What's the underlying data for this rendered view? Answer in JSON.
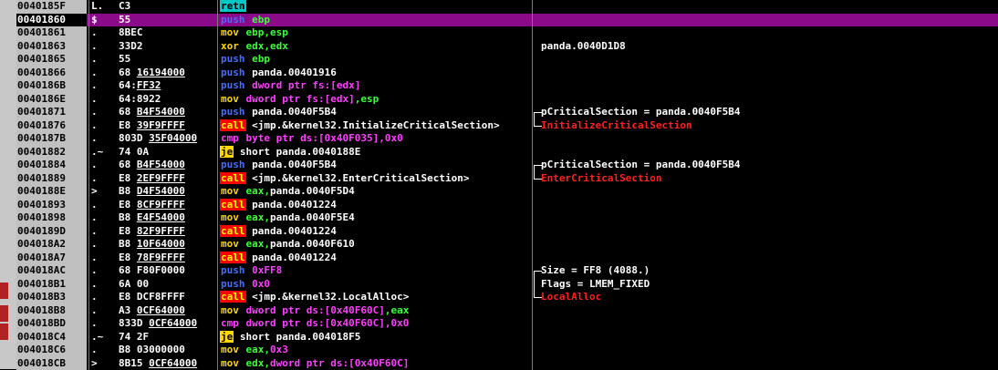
{
  "rows": [
    {
      "addr": "0040185F",
      "flag": "L.",
      "hex": "C3",
      "hex_ul": "",
      "mn": "retn",
      "mn_cls": "retn",
      "ops": [],
      "cmt": ""
    },
    {
      "addr": "00401860",
      "flag": "$",
      "hex": "55",
      "hex_ul": "",
      "mn": "push",
      "mn_cls": "push",
      "ops": [
        [
          "ebp",
          "reg"
        ]
      ],
      "cmt": "",
      "selected": true
    },
    {
      "addr": "00401861",
      "flag": ".",
      "hex": "8BEC",
      "hex_ul": "",
      "mn": "mov",
      "mn_cls": "mov",
      "ops": [
        [
          "ebp,esp",
          "reg"
        ]
      ],
      "cmt": ""
    },
    {
      "addr": "00401863",
      "flag": ".",
      "hex": "33D2",
      "hex_ul": "",
      "mn": "xor",
      "mn_cls": "xor",
      "ops": [
        [
          "edx,edx",
          "reg"
        ]
      ],
      "cmt": "panda.0040D1D8"
    },
    {
      "addr": "00401865",
      "flag": ".",
      "hex": "55",
      "hex_ul": "",
      "mn": "push",
      "mn_cls": "push",
      "ops": [
        [
          "ebp",
          "reg"
        ]
      ],
      "cmt": ""
    },
    {
      "addr": "00401866",
      "flag": ".",
      "hex": "68 ",
      "hex_ul": "16194000",
      "mn": "push",
      "mn_cls": "push",
      "ops": [
        [
          "panda.00401916",
          "op"
        ]
      ],
      "cmt": ""
    },
    {
      "addr": "0040186B",
      "flag": ".",
      "hex": "64:",
      "hex_ul": "FF32",
      "mn": "push",
      "mn_cls": "push",
      "ops": [
        [
          "dword ptr fs:[edx]",
          "mem"
        ]
      ],
      "cmt": ""
    },
    {
      "addr": "0040186E",
      "flag": ".",
      "hex": "64:8922",
      "hex_ul": "",
      "mn": "mov",
      "mn_cls": "mov",
      "ops": [
        [
          "dword ptr fs:[edx]",
          "mem"
        ],
        [
          ",esp",
          "reg"
        ]
      ],
      "cmt": ""
    },
    {
      "addr": "00401871",
      "flag": ".",
      "hex": "68 ",
      "hex_ul": "B4F54000",
      "mn": "push",
      "mn_cls": "push",
      "ops": [
        [
          "panda.0040F5B4",
          "op"
        ]
      ],
      "cmt": "pCriticalSection = panda.0040F5B4",
      "br": "top"
    },
    {
      "addr": "00401876",
      "flag": ".",
      "hex": "E8 ",
      "hex_ul": "39F9FFFF",
      "mn": "call",
      "mn_cls": "call",
      "ops": [
        [
          "<jmp.&kernel32.InitializeCriticalSection>",
          "op"
        ]
      ],
      "cmt": "InitializeCriticalSection",
      "cmt_red": true,
      "br": "bot"
    },
    {
      "addr": "0040187B",
      "flag": ".",
      "hex": "803D ",
      "hex_ul": "35F04000",
      "mn": "cmp",
      "mn_cls": "cmp",
      "ops": [
        [
          "byte ptr ds:[0x40F035]",
          "mem"
        ],
        [
          ",0x0",
          "mem"
        ]
      ],
      "cmt": ""
    },
    {
      "addr": "00401882",
      "flag": ".~",
      "hex": "74 0A",
      "hex_ul": "",
      "mn": "je",
      "mn_cls": "je",
      "ops": [
        [
          "short panda.0040188E",
          "op"
        ]
      ],
      "cmt": ""
    },
    {
      "addr": "00401884",
      "flag": ".",
      "hex": "68 ",
      "hex_ul": "B4F54000",
      "mn": "push",
      "mn_cls": "push",
      "ops": [
        [
          "panda.0040F5B4",
          "op"
        ]
      ],
      "cmt": "pCriticalSection = panda.0040F5B4",
      "br": "top"
    },
    {
      "addr": "00401889",
      "flag": ".",
      "hex": "E8 ",
      "hex_ul": "2EF9FFFF",
      "mn": "call",
      "mn_cls": "call",
      "ops": [
        [
          "<jmp.&kernel32.EnterCriticalSection>",
          "op"
        ]
      ],
      "cmt": "EnterCriticalSection",
      "cmt_red": true,
      "br": "bot"
    },
    {
      "addr": "0040188E",
      "flag": ">",
      "hex": "B8 ",
      "hex_ul": "D4F54000",
      "mn": "mov",
      "mn_cls": "mov",
      "ops": [
        [
          "eax,",
          "reg"
        ],
        [
          "panda.0040F5D4",
          "op"
        ]
      ],
      "cmt": ""
    },
    {
      "addr": "00401893",
      "flag": ".",
      "hex": "E8 ",
      "hex_ul": "8CF9FFFF",
      "mn": "call",
      "mn_cls": "call",
      "ops": [
        [
          "panda.00401224",
          "op"
        ]
      ],
      "cmt": ""
    },
    {
      "addr": "00401898",
      "flag": ".",
      "hex": "B8 ",
      "hex_ul": "E4F54000",
      "mn": "mov",
      "mn_cls": "mov",
      "ops": [
        [
          "eax,",
          "reg"
        ],
        [
          "panda.0040F5E4",
          "op"
        ]
      ],
      "cmt": ""
    },
    {
      "addr": "0040189D",
      "flag": ".",
      "hex": "E8 ",
      "hex_ul": "82F9FFFF",
      "mn": "call",
      "mn_cls": "call",
      "ops": [
        [
          "panda.00401224",
          "op"
        ]
      ],
      "cmt": ""
    },
    {
      "addr": "004018A2",
      "flag": ".",
      "hex": "B8 ",
      "hex_ul": "10F64000",
      "mn": "mov",
      "mn_cls": "mov",
      "ops": [
        [
          "eax,",
          "reg"
        ],
        [
          "panda.0040F610",
          "op"
        ]
      ],
      "cmt": ""
    },
    {
      "addr": "004018A7",
      "flag": ".",
      "hex": "E8 ",
      "hex_ul": "78F9FFFF",
      "mn": "call",
      "mn_cls": "call",
      "ops": [
        [
          "panda.00401224",
          "op"
        ]
      ],
      "cmt": ""
    },
    {
      "addr": "004018AC",
      "flag": ".",
      "hex": "68 F80F0000",
      "hex_ul": "",
      "mn": "push",
      "mn_cls": "push",
      "ops": [
        [
          "0xFF8",
          "mem"
        ]
      ],
      "cmt": "Size = FF8 (4088.)",
      "br": "top"
    },
    {
      "addr": "004018B1",
      "flag": ".",
      "hex": "6A 00",
      "hex_ul": "",
      "mn": "push",
      "mn_cls": "push",
      "ops": [
        [
          "0x0",
          "mem"
        ]
      ],
      "cmt": "Flags = LMEM_FIXED",
      "br": "mid"
    },
    {
      "addr": "004018B3",
      "flag": ".",
      "hex": "E8 DCF8FFFF",
      "hex_ul": "",
      "mn": "call",
      "mn_cls": "call",
      "ops": [
        [
          "<jmp.&kernel32.LocalAlloc>",
          "op"
        ]
      ],
      "cmt": "LocalAlloc",
      "cmt_red": true,
      "br": "bot"
    },
    {
      "addr": "004018B8",
      "flag": ".",
      "hex": "A3 ",
      "hex_ul": "0CF64000",
      "mn": "mov",
      "mn_cls": "mov",
      "ops": [
        [
          "dword ptr ds:[0x40F60C]",
          "mem"
        ],
        [
          ",eax",
          "reg"
        ]
      ],
      "cmt": ""
    },
    {
      "addr": "004018BD",
      "flag": ".",
      "hex": "833D ",
      "hex_ul": "0CF64000",
      "mn": "cmp",
      "mn_cls": "cmp",
      "ops": [
        [
          "dword ptr ds:[0x40F60C]",
          "mem"
        ],
        [
          ",0x0",
          "mem"
        ]
      ],
      "cmt": ""
    },
    {
      "addr": "004018C4",
      "flag": ".~",
      "hex": "74 2F",
      "hex_ul": "",
      "mn": "je",
      "mn_cls": "je",
      "ops": [
        [
          "short panda.004018F5",
          "op"
        ]
      ],
      "cmt": ""
    },
    {
      "addr": "004018C6",
      "flag": ".",
      "hex": "B8 03000000",
      "hex_ul": "",
      "mn": "mov",
      "mn_cls": "mov",
      "ops": [
        [
          "eax,",
          "reg"
        ],
        [
          "0x3",
          "mem"
        ]
      ],
      "cmt": ""
    },
    {
      "addr": "004018CB",
      "flag": ">",
      "hex": "8B15 ",
      "hex_ul": "0CF64000",
      "mn": "mov",
      "mn_cls": "mov",
      "ops": [
        [
          "edx,",
          "reg"
        ],
        [
          "dword ptr ds:[0x40F60C]",
          "mem"
        ]
      ],
      "cmt": ""
    }
  ],
  "colors": {
    "selected_row": "#8a0a8a",
    "call_bg": "#ff0000",
    "call_fg": "#ffff00",
    "push_fg": "#4a6cff",
    "mov_fg": "#ffd700",
    "cmp_fg": "#ff40ff",
    "je_bg": "#ffd700",
    "retn_bg": "#00c8c8"
  }
}
